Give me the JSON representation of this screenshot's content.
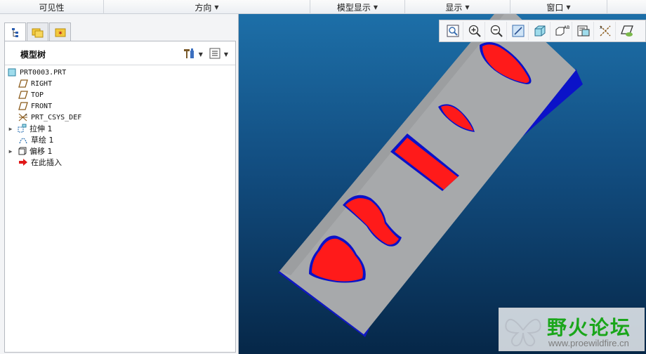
{
  "ribbon": {
    "groups": [
      {
        "label": "可见性",
        "has_menu": false
      },
      {
        "label": "方向",
        "has_menu": true
      },
      {
        "label": "模型显示",
        "has_menu": true
      },
      {
        "label": "显示",
        "has_menu": true
      },
      {
        "label": "窗口",
        "has_menu": true
      },
      {
        "label": "",
        "has_menu": false
      }
    ]
  },
  "navigator": {
    "tabs": [
      {
        "name": "model-tree-tab",
        "icon": "tree-icon",
        "active": true
      },
      {
        "name": "folder-browser-tab",
        "icon": "folders-icon",
        "active": false
      },
      {
        "name": "favorites-tab",
        "icon": "star-folder-icon",
        "active": false
      }
    ],
    "title": "模型树",
    "tree": [
      {
        "label": "PRT0003.PRT",
        "icon": "part-icon",
        "expander": false,
        "indent": 0
      },
      {
        "label": "RIGHT",
        "icon": "datum-plane-icon",
        "expander": false,
        "indent": 1
      },
      {
        "label": "TOP",
        "icon": "datum-plane-icon",
        "expander": false,
        "indent": 1
      },
      {
        "label": "FRONT",
        "icon": "datum-plane-icon",
        "expander": false,
        "indent": 1
      },
      {
        "label": "PRT_CSYS_DEF",
        "icon": "csys-icon",
        "expander": false,
        "indent": 1
      },
      {
        "label": "拉伸 1",
        "icon": "extrude-icon",
        "expander": true,
        "indent": 1
      },
      {
        "label": "草绘 1",
        "icon": "sketch-icon",
        "expander": false,
        "indent": 1
      },
      {
        "label": "偏移 1",
        "icon": "offset-icon",
        "expander": true,
        "indent": 1
      },
      {
        "label": "在此插入",
        "icon": "insert-here-arrow-icon",
        "expander": false,
        "indent": 1
      }
    ]
  },
  "viewport": {
    "toolbar": [
      "refit-icon",
      "zoom-in-icon",
      "zoom-out-icon",
      "repaint-icon",
      "display-style-icon",
      "saved-views-icon",
      "view-manager-icon",
      "datum-display-icon",
      "annotation-display-icon"
    ],
    "watermark": {
      "title": "野火论坛",
      "url": "www.proewildfire.cn"
    },
    "colors": {
      "surface": "#a9a9a9",
      "offset_faces": "#ff1a1a",
      "side_face": "#0b12c8"
    }
  }
}
